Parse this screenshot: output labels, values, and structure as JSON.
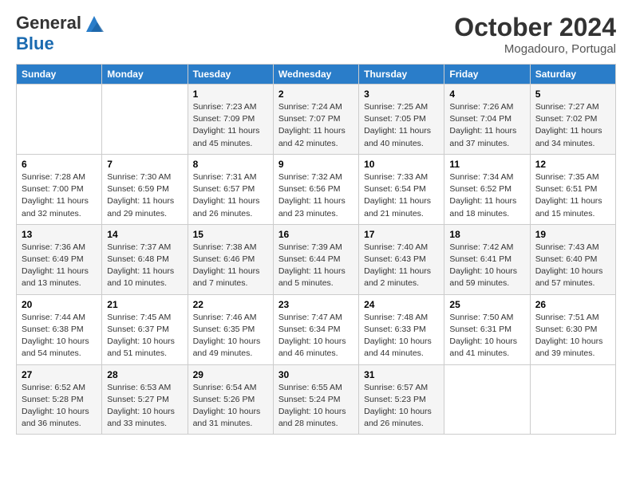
{
  "header": {
    "logo_general": "General",
    "logo_blue": "Blue",
    "title": "October 2024",
    "subtitle": "Mogadouro, Portugal"
  },
  "days_of_week": [
    "Sunday",
    "Monday",
    "Tuesday",
    "Wednesday",
    "Thursday",
    "Friday",
    "Saturday"
  ],
  "weeks": [
    [
      null,
      null,
      {
        "day": "1",
        "sunrise": "7:23 AM",
        "sunset": "7:09 PM",
        "daylight": "11 hours and 45 minutes."
      },
      {
        "day": "2",
        "sunrise": "7:24 AM",
        "sunset": "7:07 PM",
        "daylight": "11 hours and 42 minutes."
      },
      {
        "day": "3",
        "sunrise": "7:25 AM",
        "sunset": "7:05 PM",
        "daylight": "11 hours and 40 minutes."
      },
      {
        "day": "4",
        "sunrise": "7:26 AM",
        "sunset": "7:04 PM",
        "daylight": "11 hours and 37 minutes."
      },
      {
        "day": "5",
        "sunrise": "7:27 AM",
        "sunset": "7:02 PM",
        "daylight": "11 hours and 34 minutes."
      }
    ],
    [
      {
        "day": "6",
        "sunrise": "7:28 AM",
        "sunset": "7:00 PM",
        "daylight": "11 hours and 32 minutes."
      },
      {
        "day": "7",
        "sunrise": "7:30 AM",
        "sunset": "6:59 PM",
        "daylight": "11 hours and 29 minutes."
      },
      {
        "day": "8",
        "sunrise": "7:31 AM",
        "sunset": "6:57 PM",
        "daylight": "11 hours and 26 minutes."
      },
      {
        "day": "9",
        "sunrise": "7:32 AM",
        "sunset": "6:56 PM",
        "daylight": "11 hours and 23 minutes."
      },
      {
        "day": "10",
        "sunrise": "7:33 AM",
        "sunset": "6:54 PM",
        "daylight": "11 hours and 21 minutes."
      },
      {
        "day": "11",
        "sunrise": "7:34 AM",
        "sunset": "6:52 PM",
        "daylight": "11 hours and 18 minutes."
      },
      {
        "day": "12",
        "sunrise": "7:35 AM",
        "sunset": "6:51 PM",
        "daylight": "11 hours and 15 minutes."
      }
    ],
    [
      {
        "day": "13",
        "sunrise": "7:36 AM",
        "sunset": "6:49 PM",
        "daylight": "11 hours and 13 minutes."
      },
      {
        "day": "14",
        "sunrise": "7:37 AM",
        "sunset": "6:48 PM",
        "daylight": "11 hours and 10 minutes."
      },
      {
        "day": "15",
        "sunrise": "7:38 AM",
        "sunset": "6:46 PM",
        "daylight": "11 hours and 7 minutes."
      },
      {
        "day": "16",
        "sunrise": "7:39 AM",
        "sunset": "6:44 PM",
        "daylight": "11 hours and 5 minutes."
      },
      {
        "day": "17",
        "sunrise": "7:40 AM",
        "sunset": "6:43 PM",
        "daylight": "11 hours and 2 minutes."
      },
      {
        "day": "18",
        "sunrise": "7:42 AM",
        "sunset": "6:41 PM",
        "daylight": "10 hours and 59 minutes."
      },
      {
        "day": "19",
        "sunrise": "7:43 AM",
        "sunset": "6:40 PM",
        "daylight": "10 hours and 57 minutes."
      }
    ],
    [
      {
        "day": "20",
        "sunrise": "7:44 AM",
        "sunset": "6:38 PM",
        "daylight": "10 hours and 54 minutes."
      },
      {
        "day": "21",
        "sunrise": "7:45 AM",
        "sunset": "6:37 PM",
        "daylight": "10 hours and 51 minutes."
      },
      {
        "day": "22",
        "sunrise": "7:46 AM",
        "sunset": "6:35 PM",
        "daylight": "10 hours and 49 minutes."
      },
      {
        "day": "23",
        "sunrise": "7:47 AM",
        "sunset": "6:34 PM",
        "daylight": "10 hours and 46 minutes."
      },
      {
        "day": "24",
        "sunrise": "7:48 AM",
        "sunset": "6:33 PM",
        "daylight": "10 hours and 44 minutes."
      },
      {
        "day": "25",
        "sunrise": "7:50 AM",
        "sunset": "6:31 PM",
        "daylight": "10 hours and 41 minutes."
      },
      {
        "day": "26",
        "sunrise": "7:51 AM",
        "sunset": "6:30 PM",
        "daylight": "10 hours and 39 minutes."
      }
    ],
    [
      {
        "day": "27",
        "sunrise": "6:52 AM",
        "sunset": "5:28 PM",
        "daylight": "10 hours and 36 minutes."
      },
      {
        "day": "28",
        "sunrise": "6:53 AM",
        "sunset": "5:27 PM",
        "daylight": "10 hours and 33 minutes."
      },
      {
        "day": "29",
        "sunrise": "6:54 AM",
        "sunset": "5:26 PM",
        "daylight": "10 hours and 31 minutes."
      },
      {
        "day": "30",
        "sunrise": "6:55 AM",
        "sunset": "5:24 PM",
        "daylight": "10 hours and 28 minutes."
      },
      {
        "day": "31",
        "sunrise": "6:57 AM",
        "sunset": "5:23 PM",
        "daylight": "10 hours and 26 minutes."
      },
      null,
      null
    ]
  ],
  "labels": {
    "sunrise_prefix": "Sunrise: ",
    "sunset_prefix": "Sunset: ",
    "daylight_prefix": "Daylight: "
  }
}
